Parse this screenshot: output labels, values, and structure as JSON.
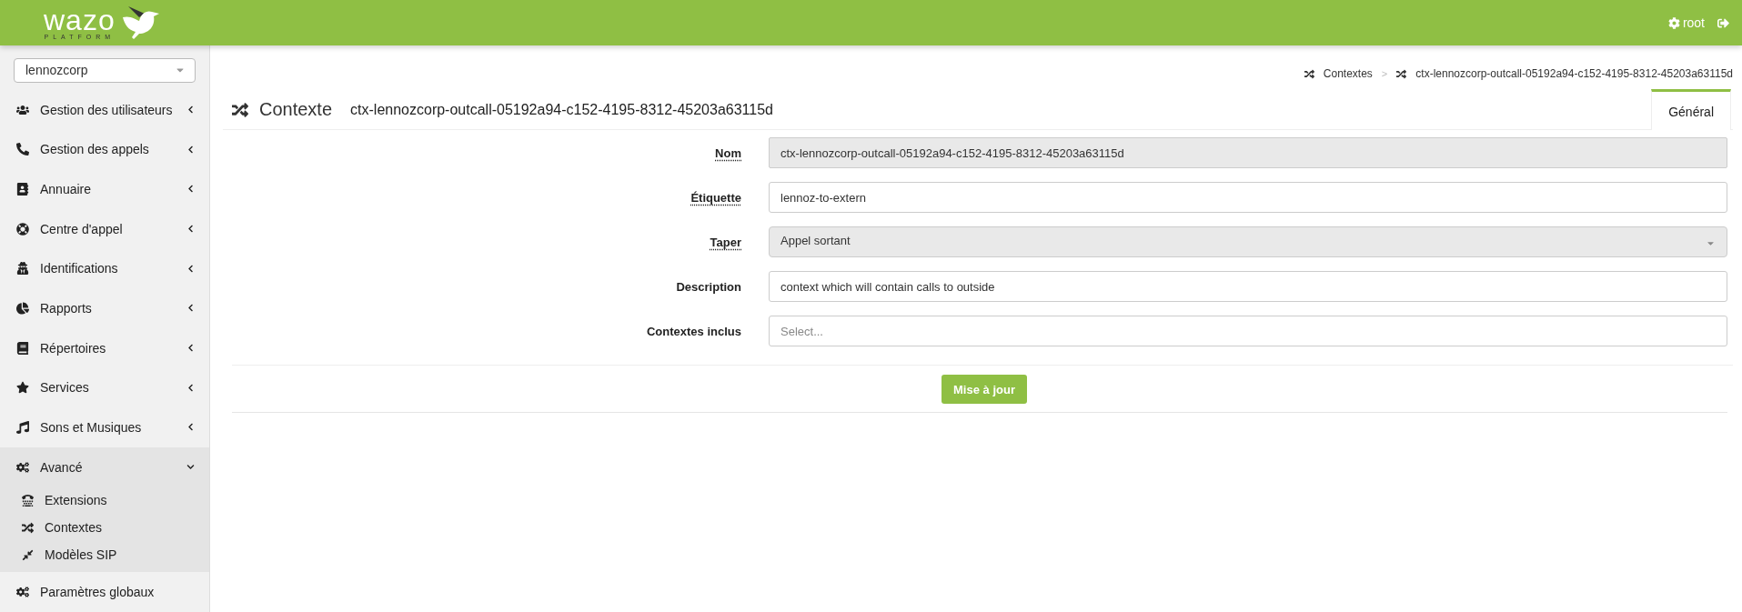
{
  "header": {
    "logo_text": "wazo",
    "logo_subtitle": "PLATFORM",
    "user": "root"
  },
  "sidebar": {
    "tenant": "lennozcorp",
    "items": [
      {
        "label": "Gestion des utilisateurs",
        "expanded": false
      },
      {
        "label": "Gestion des appels",
        "expanded": false
      },
      {
        "label": "Annuaire",
        "expanded": false
      },
      {
        "label": "Centre d'appel",
        "expanded": false
      },
      {
        "label": "Identifications",
        "expanded": false
      },
      {
        "label": "Rapports",
        "expanded": false
      },
      {
        "label": "Répertoires",
        "expanded": false
      },
      {
        "label": "Services",
        "expanded": false
      },
      {
        "label": "Sons et Musiques",
        "expanded": false
      },
      {
        "label": "Avancé",
        "expanded": true,
        "children": [
          {
            "label": "Extensions"
          },
          {
            "label": "Contextes"
          },
          {
            "label": "Modèles SIP"
          }
        ]
      },
      {
        "label": "Paramètres globaux"
      }
    ]
  },
  "breadcrumb": [
    "Contextes",
    "ctx-lennozcorp-outcall-05192a94-c152-4195-8312-45203a63115d"
  ],
  "breadcrumb_separator": ">",
  "page": {
    "title": "Contexte",
    "subtitle": "ctx-lennozcorp-outcall-05192a94-c152-4195-8312-45203a63115d"
  },
  "tabs": [
    {
      "label": "Général",
      "selected": true
    }
  ],
  "form": {
    "fields": [
      {
        "kind": "text",
        "label": "Nom",
        "tooltip": true,
        "disabled": true,
        "value": "ctx-lennozcorp-outcall-05192a94-c152-4195-8312-45203a63115d"
      },
      {
        "kind": "text",
        "label": "Étiquette",
        "tooltip": true,
        "disabled": false,
        "value": "lennoz-to-extern"
      },
      {
        "kind": "select",
        "label": "Taper",
        "tooltip": true,
        "disabled": true,
        "value": "Appel sortant"
      },
      {
        "kind": "text",
        "label": "Description",
        "tooltip": false,
        "disabled": false,
        "value": "context which will contain calls to outside"
      },
      {
        "kind": "multiselect",
        "label": "Contextes inclus",
        "tooltip": false,
        "disabled": false,
        "placeholder": "Select..."
      }
    ],
    "submit": "Mise à jour"
  }
}
